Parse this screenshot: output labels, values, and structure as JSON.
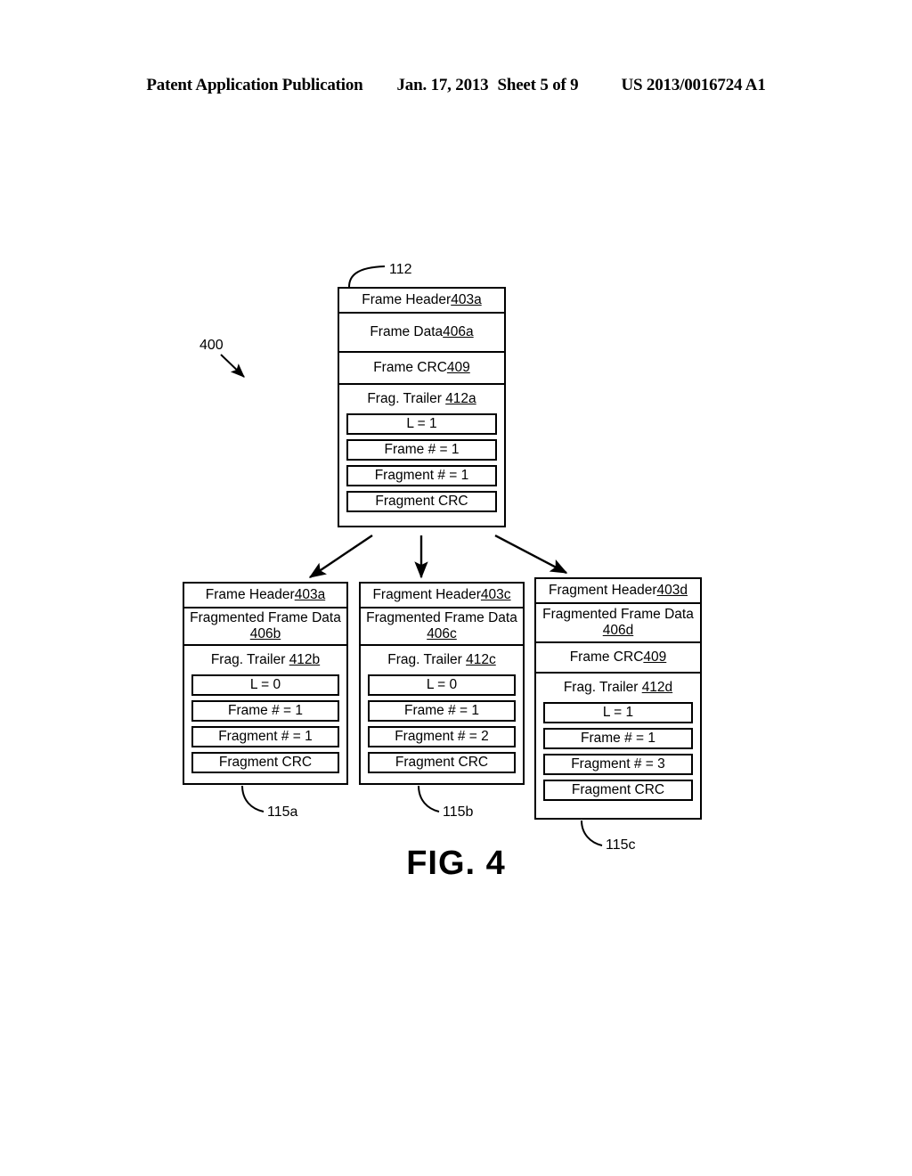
{
  "page_header": {
    "publication": "Patent Application Publication",
    "date": "Jan. 17, 2013",
    "sheet": "Sheet 5 of 9",
    "pub_number": "US 2013/0016724 A1"
  },
  "figure": {
    "caption": "FIG. 4",
    "diagram_ref": "400",
    "top_block": {
      "ref": "112",
      "rows": [
        {
          "label": "Frame Header ",
          "ref": "403a"
        },
        {
          "label": "Frame Data ",
          "ref": "406a"
        },
        {
          "label": "Frame CRC ",
          "ref": "409"
        }
      ],
      "trailer": {
        "label": "Frag. Trailer ",
        "ref": "412a",
        "fields": [
          "L = 1",
          "Frame # = 1",
          "Fragment # = 1",
          "Fragment CRC"
        ]
      }
    },
    "fragments": [
      {
        "ref": "115a",
        "header": {
          "label": "Frame Header ",
          "ref": "403a"
        },
        "data": {
          "label": "Fragmented Frame Data",
          "ref": "406b"
        },
        "frame_crc": null,
        "trailer": {
          "label": "Frag. Trailer ",
          "ref": "412b",
          "fields": [
            "L = 0",
            "Frame # = 1",
            "Fragment # = 1",
            "Fragment CRC"
          ]
        }
      },
      {
        "ref": "115b",
        "header": {
          "label": "Fragment Header ",
          "ref": "403c"
        },
        "data": {
          "label": "Fragmented Frame Data",
          "ref": "406c"
        },
        "frame_crc": null,
        "trailer": {
          "label": "Frag. Trailer ",
          "ref": "412c",
          "fields": [
            "L = 0",
            "Frame # = 1",
            "Fragment # = 2",
            "Fragment CRC"
          ]
        }
      },
      {
        "ref": "115c",
        "header": {
          "label": "Fragment Header ",
          "ref": "403d"
        },
        "data": {
          "label": "Fragmented Frame Data",
          "ref": "406d"
        },
        "frame_crc": {
          "label": "Frame CRC ",
          "ref": "409"
        },
        "trailer": {
          "label": "Frag. Trailer ",
          "ref": "412d",
          "fields": [
            "L = 1",
            "Frame # = 1",
            "Fragment # = 3",
            "Fragment CRC"
          ]
        }
      }
    ]
  },
  "colors": {
    "ink": "#000000",
    "paper": "#ffffff"
  }
}
